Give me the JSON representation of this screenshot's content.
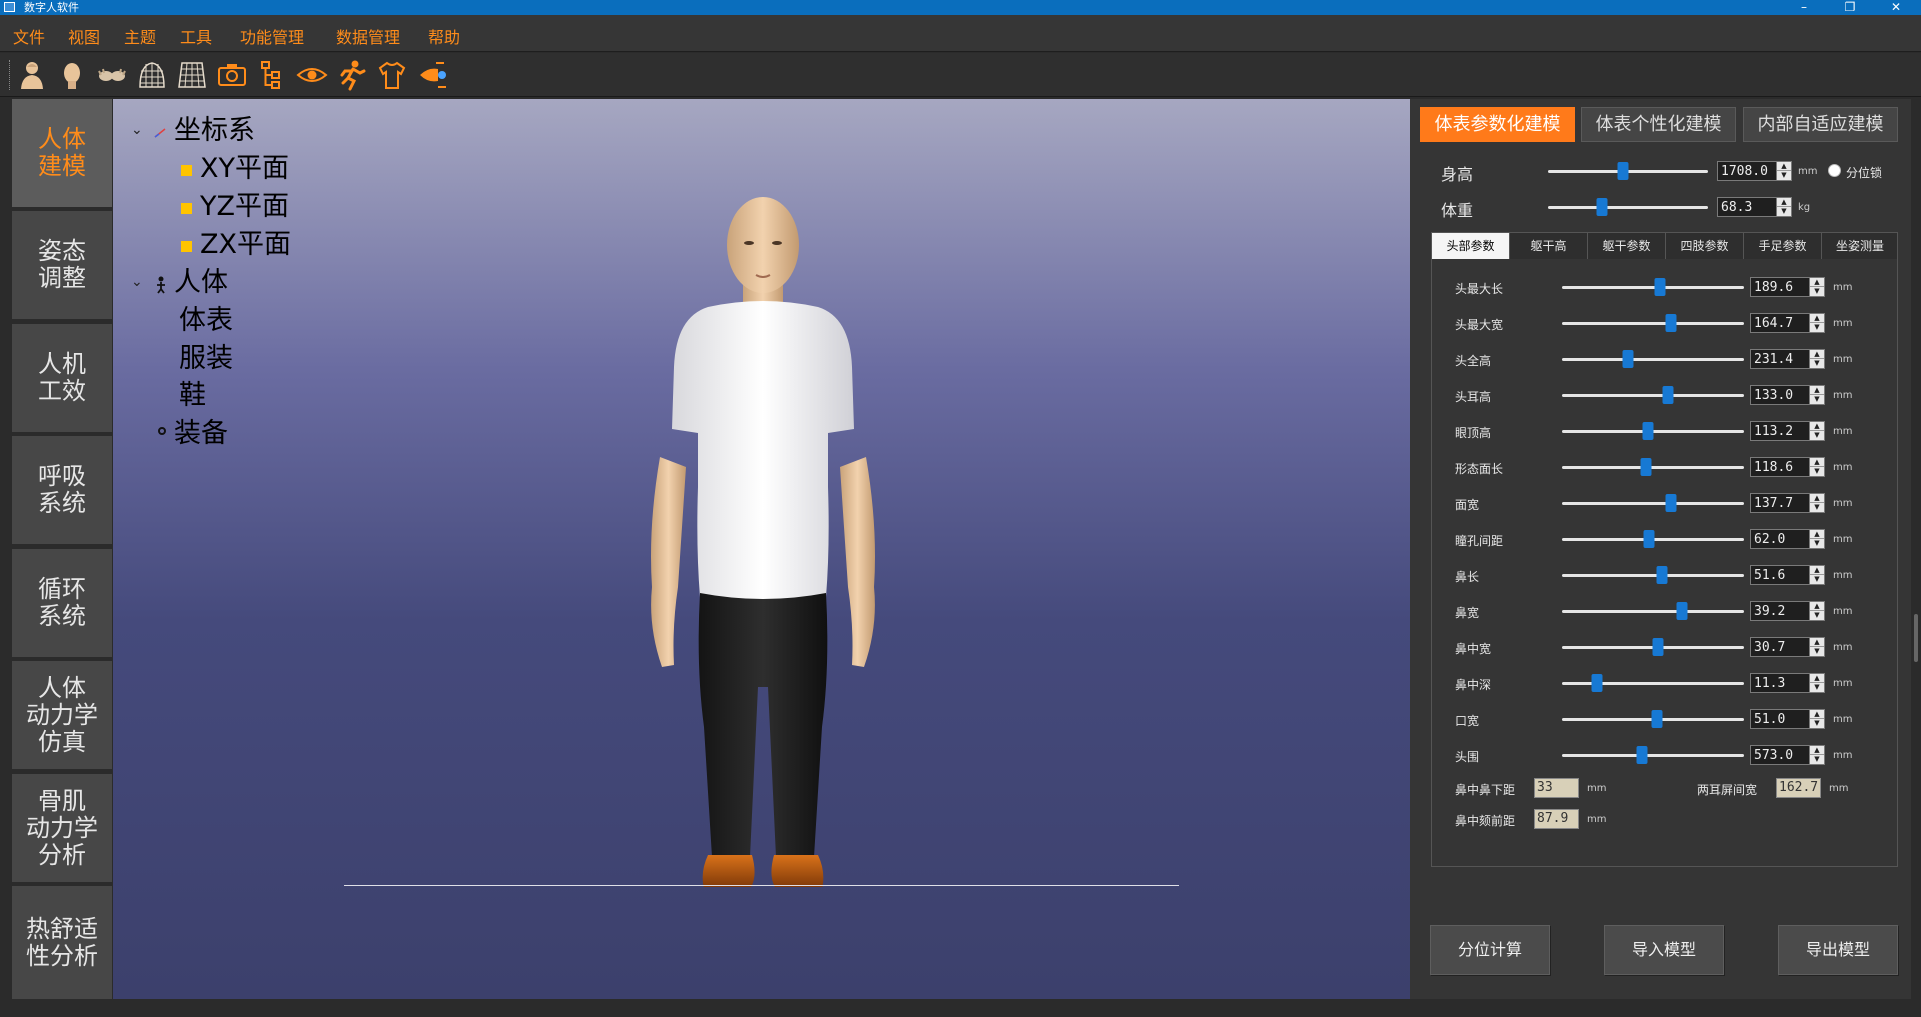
{
  "window": {
    "title": "数字人软件",
    "minimize": "–",
    "restore": "❐",
    "close": "✕"
  },
  "menu": [
    "文件",
    "视图",
    "主题",
    "工具",
    "功能管理",
    "数据管理",
    "帮助"
  ],
  "toolbar": {
    "icons": [
      "body-model-icon",
      "head-icon",
      "hands-icon",
      "mesh-surface-icon",
      "grid-icon",
      "camera-icon",
      "tree-hierarchy-icon",
      "eye-icon",
      "running-pose-icon",
      "clothing-icon",
      "airflow-icon"
    ]
  },
  "sidebar": {
    "items": [
      "人体\n建模",
      "姿态\n调整",
      "人机\n工效",
      "呼吸\n系统",
      "循环\n系统",
      "人体\n动力学\n仿真",
      "骨肌\n动力学\n分析",
      "热舒适\n性分析"
    ]
  },
  "tree": {
    "root1": "坐标系",
    "planes": [
      "XY平面",
      "YZ平面",
      "ZX平面"
    ],
    "root2": "人体",
    "body_children": [
      "体表",
      "服装",
      "鞋"
    ],
    "equipment": "装备"
  },
  "panel": {
    "tabs": [
      "体表参数化建模",
      "体表个性化建模",
      "内部自适应建模"
    ],
    "height": {
      "label": "身高",
      "value": "1708.0",
      "unit": "mm",
      "fraction": 0.47
    },
    "weight": {
      "label": "体重",
      "value": "68.3",
      "unit": "kg",
      "fraction": 0.34
    },
    "lock_label": "分位锁",
    "subtabs": [
      "头部参数",
      "躯干高",
      "躯干参数",
      "四肢参数",
      "手足参数",
      "坐姿测量"
    ],
    "params": [
      {
        "label": "头最大长",
        "value": "189.6",
        "unit": "mm",
        "fraction": 0.54
      },
      {
        "label": "头最大宽",
        "value": "164.7",
        "unit": "mm",
        "fraction": 0.6
      },
      {
        "label": "头全高",
        "value": "231.4",
        "unit": "mm",
        "fraction": 0.36
      },
      {
        "label": "头耳高",
        "value": "133.0",
        "unit": "mm",
        "fraction": 0.58
      },
      {
        "label": "眼顶高",
        "value": "113.2",
        "unit": "mm",
        "fraction": 0.47
      },
      {
        "label": "形态面长",
        "value": "118.6",
        "unit": "mm",
        "fraction": 0.46
      },
      {
        "label": "面宽",
        "value": "137.7",
        "unit": "mm",
        "fraction": 0.6
      },
      {
        "label": "瞳孔间距",
        "value": "62.0",
        "unit": "mm",
        "fraction": 0.48
      },
      {
        "label": "鼻长",
        "value": "51.6",
        "unit": "mm",
        "fraction": 0.55
      },
      {
        "label": "鼻宽",
        "value": "39.2",
        "unit": "mm",
        "fraction": 0.66
      },
      {
        "label": "鼻中宽",
        "value": "30.7",
        "unit": "mm",
        "fraction": 0.53
      },
      {
        "label": "鼻中深",
        "value": "11.3",
        "unit": "mm",
        "fraction": 0.19
      },
      {
        "label": "口宽",
        "value": "51.0",
        "unit": "mm",
        "fraction": 0.52
      },
      {
        "label": "头围",
        "value": "573.0",
        "unit": "mm",
        "fraction": 0.44
      }
    ],
    "readonly": [
      {
        "label": "鼻中鼻下距",
        "value": "33",
        "unit": "mm"
      },
      {
        "label": "两耳屏间宽",
        "value": "162.7",
        "unit": "mm"
      },
      {
        "label": "鼻中颏前距",
        "value": "87.9",
        "unit": "mm"
      }
    ],
    "buttons": [
      "分位计算",
      "导入模型",
      "导出模型"
    ]
  },
  "colors": {
    "accent": "#ff8c1a",
    "titlebar": "#0a6ebd",
    "slider_thumb": "#1779d4"
  }
}
